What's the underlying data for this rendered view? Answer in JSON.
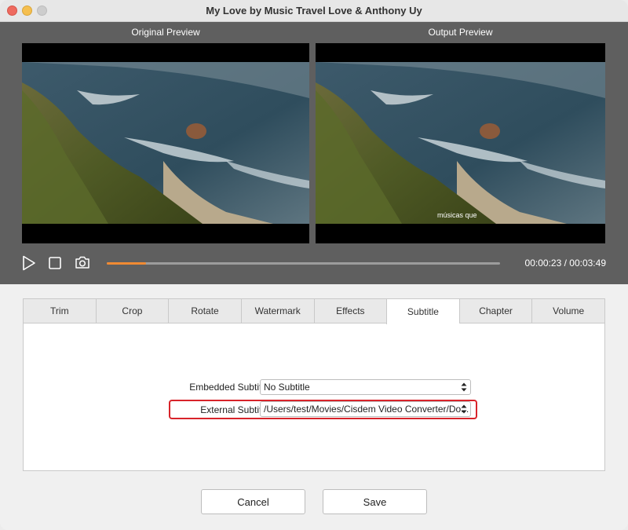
{
  "window": {
    "title": "My Love by Music Travel Love & Anthony Uy"
  },
  "preview": {
    "original_label": "Original Preview",
    "output_label": "Output  Preview",
    "output_subtitle_text": "músicas que"
  },
  "player": {
    "current_time": "00:00:23",
    "separator": " / ",
    "total_time": "00:03:49",
    "progress_fraction": 0.1,
    "accent_color": "#f08a33"
  },
  "tabs": [
    {
      "label": "Trim",
      "active": false
    },
    {
      "label": "Crop",
      "active": false
    },
    {
      "label": "Rotate",
      "active": false
    },
    {
      "label": "Watermark",
      "active": false
    },
    {
      "label": "Effects",
      "active": false
    },
    {
      "label": "Subtitle",
      "active": true
    },
    {
      "label": "Chapter",
      "active": false
    },
    {
      "label": "Volume",
      "active": false
    }
  ],
  "subtitle_panel": {
    "embedded_label": "Embedded Subtitles:",
    "embedded_value": "No Subtitle",
    "external_label": "External Subtitles:",
    "external_value": "/Users/test/Movies/Cisdem Video Converter/Do...",
    "highlight_color": "#d8232a"
  },
  "buttons": {
    "cancel": "Cancel",
    "save": "Save"
  },
  "icons": {
    "play": "play-icon",
    "stop": "stop-icon",
    "snapshot": "camera-icon",
    "select_arrows": "updown-chevron-icon"
  }
}
